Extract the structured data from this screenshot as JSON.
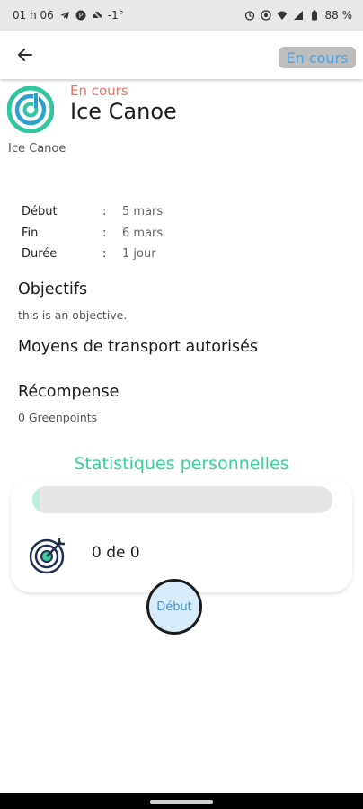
{
  "status_bar": {
    "time": "01 h 06",
    "temp": "-1°",
    "battery": "88 %",
    "icons_left": [
      "telegram-icon",
      "p-icon",
      "cloud-off-icon"
    ],
    "icons_right": [
      "alarm-icon",
      "eye-icon",
      "wifi-icon",
      "signal-icon",
      "battery-icon"
    ]
  },
  "header": {
    "back_icon": "arrow-left-icon",
    "status_chip": "En cours"
  },
  "challenge": {
    "status": "En cours",
    "title": "Ice Canoe",
    "subtitle": "Ice Canoe",
    "logo_icon": "app-logo-icon",
    "accent_color": "#3bcf9c",
    "status_color": "#e4746a"
  },
  "details": [
    {
      "label": "Début",
      "sep": ":",
      "value": "5 mars"
    },
    {
      "label": "Fin",
      "sep": ":",
      "value": "6 mars"
    },
    {
      "label": "Durée",
      "sep": ":",
      "value": "1 jour"
    }
  ],
  "objectives": {
    "heading": "Objectifs",
    "text": "this is an objective."
  },
  "transport": {
    "heading": "Moyens de transport autorisés"
  },
  "reward": {
    "heading": "Récompense",
    "text": "0 Greenpoints"
  },
  "stats": {
    "heading": "Statistiques personnelles",
    "progress_fraction": 0.0,
    "progress_text": "0 de 0",
    "target_icon": "target-icon"
  },
  "start_button": {
    "label": "Début"
  }
}
